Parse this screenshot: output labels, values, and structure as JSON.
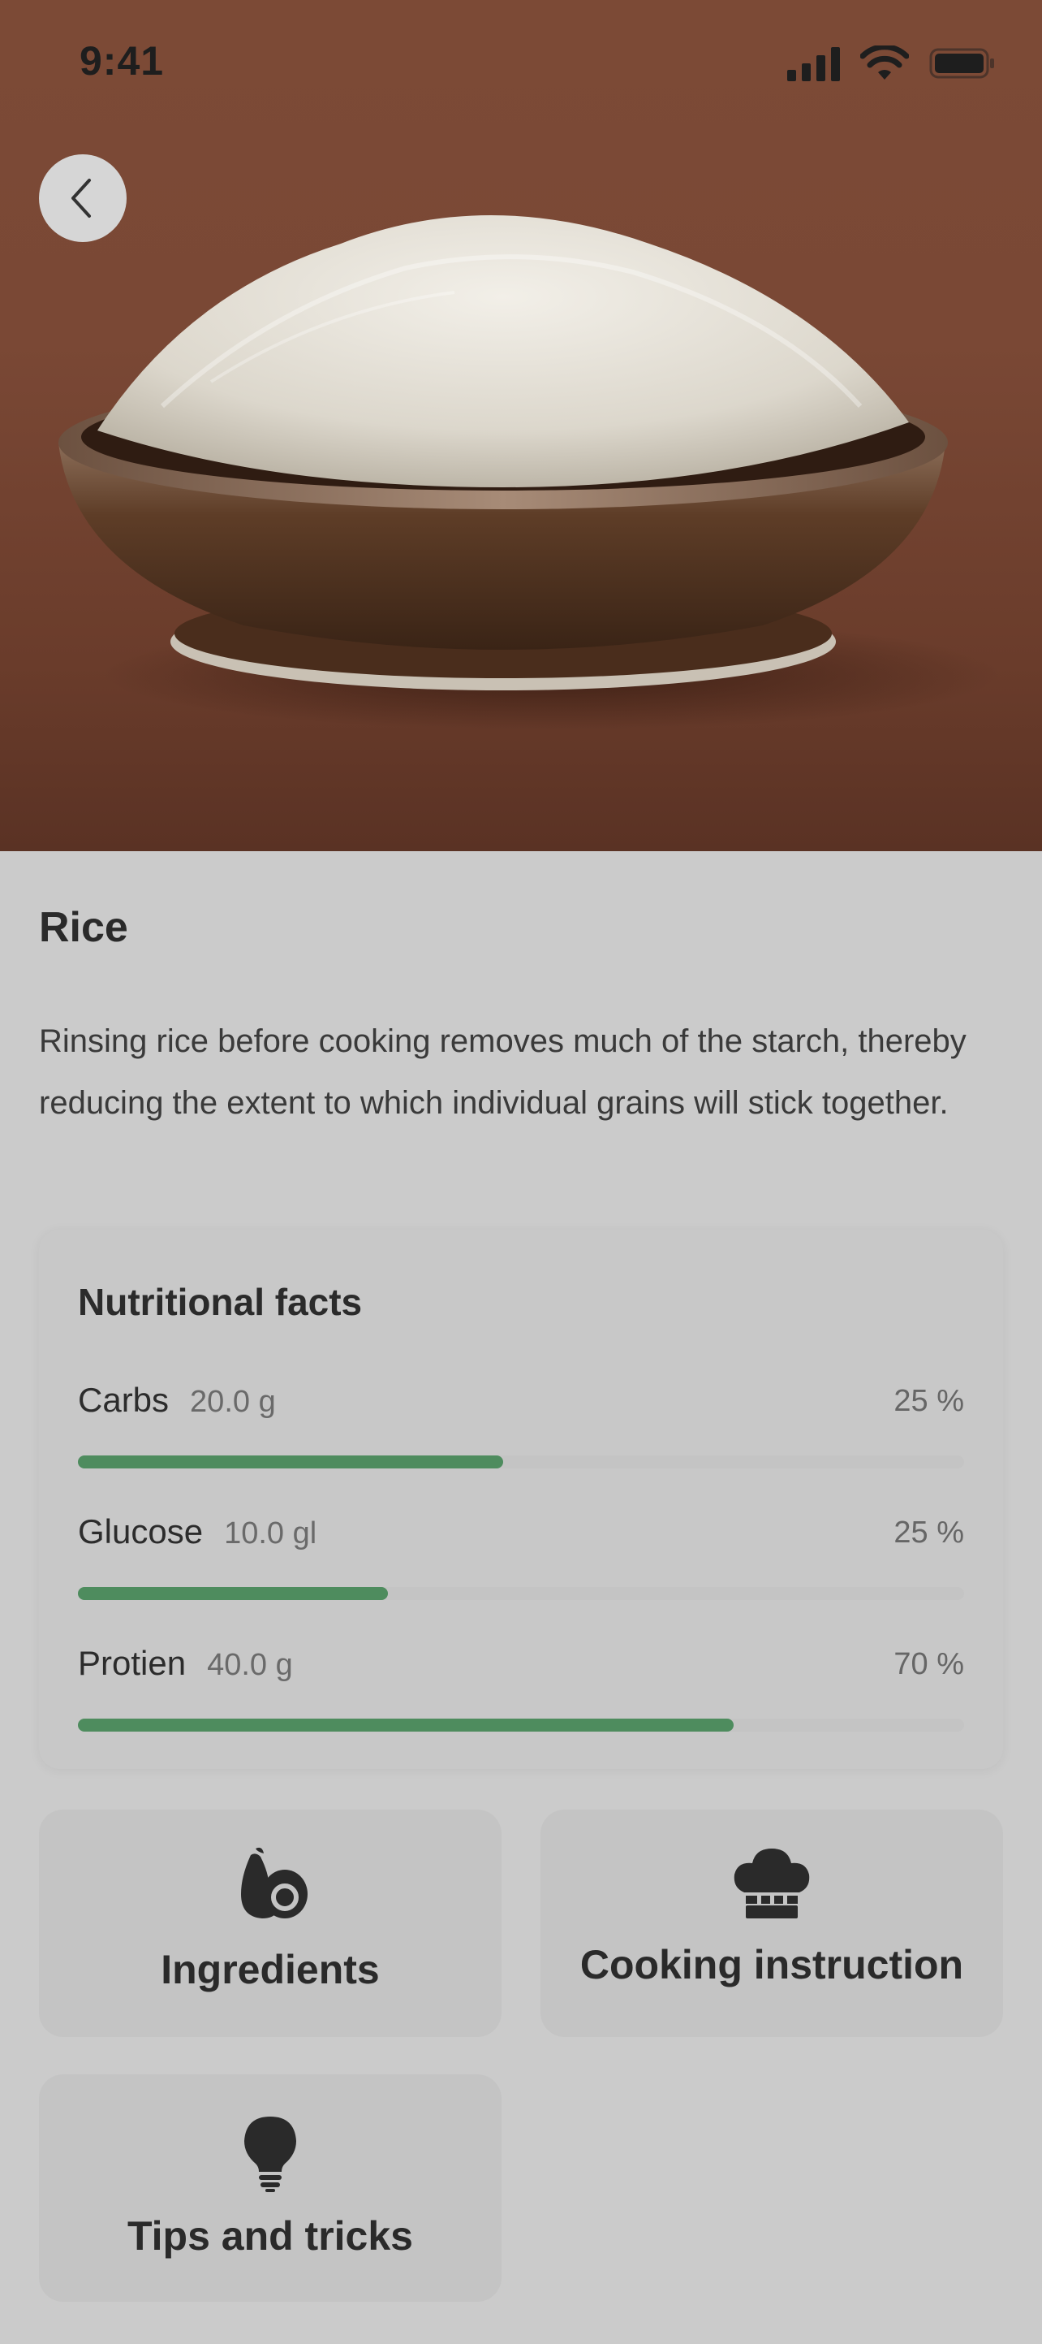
{
  "status_bar": {
    "time": "9:41"
  },
  "header": {
    "back_icon": "chevron-left-icon"
  },
  "food": {
    "title": "Rice",
    "description": "Rinsing rice before cooking removes much of the starch, thereby reducing the extent to which individual grains will stick together."
  },
  "nutrition": {
    "title": "Nutritional facts",
    "items": [
      {
        "name": "Carbs",
        "amount": "20.0 g",
        "percent": "25 %",
        "level": 0.48
      },
      {
        "name": "Glucose",
        "amount": "10.0 gl",
        "percent": "25 %",
        "level": 0.35
      },
      {
        "name": "Protien",
        "amount": "40.0 g",
        "percent": "70 %",
        "level": 0.74
      }
    ],
    "bar_color": "#4e8c5e"
  },
  "actions": [
    {
      "label": "Ingredients",
      "icon": "avocado-icon"
    },
    {
      "label": "Cooking instruction",
      "icon": "chef-hat-icon"
    },
    {
      "label": "Tips and tricks",
      "icon": "lightbulb-icon"
    }
  ]
}
